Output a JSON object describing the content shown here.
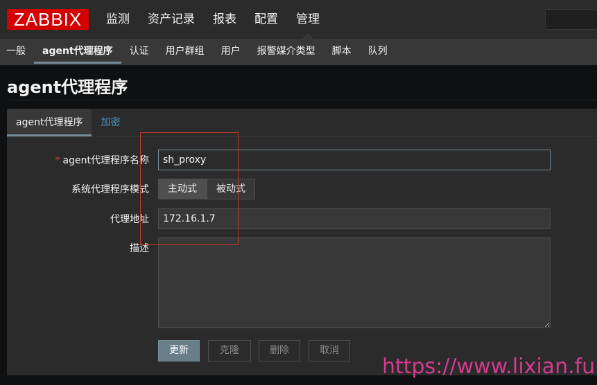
{
  "logo": "ZABBIX",
  "main_nav": [
    "监测",
    "资产记录",
    "报表",
    "配置",
    "管理"
  ],
  "sub_nav": [
    "一般",
    "agent代理程序",
    "认证",
    "用户群组",
    "用户",
    "报警媒介类型",
    "脚本",
    "队列"
  ],
  "page_title": "agent代理程序",
  "tabs": [
    "agent代理程序",
    "加密"
  ],
  "form": {
    "name_label": "agent代理程序名称",
    "name_value": "sh_proxy",
    "mode_label": "系统代理程序模式",
    "mode_options": [
      "主动式",
      "被动式"
    ],
    "address_label": "代理地址",
    "address_value": "172.16.1.7",
    "description_label": "描述",
    "description_value": ""
  },
  "buttons": {
    "update": "更新",
    "clone": "克隆",
    "delete": "删除",
    "cancel": "取消"
  },
  "watermark": "https://www.lixian.fun",
  "colors": {
    "brand_red": "#d40000",
    "accent": "#768d99",
    "link": "#4796c4",
    "required": "#e33734"
  }
}
